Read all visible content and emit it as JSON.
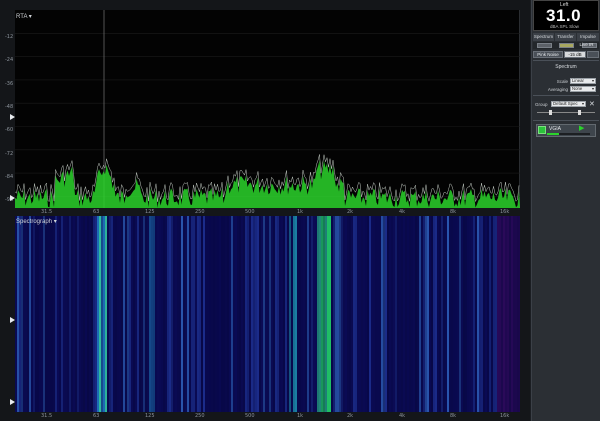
{
  "meter": {
    "channel": "Left",
    "value": "31.0",
    "unit": "dBA SPL Slow"
  },
  "tabs": [
    "Spectrum",
    "Transfer",
    "Impulse"
  ],
  "toolbar": {
    "pink_noise": "Pink Noise",
    "live_ir": "Live IR",
    "level": "-15 dB"
  },
  "spectrum_settings": {
    "title": "Spectrum",
    "scale_label": "Scale",
    "scale_value": "Linear",
    "averaging_label": "Averaging",
    "averaging_value": "None",
    "group_label": "Group",
    "group_value": "Default Spec"
  },
  "input": {
    "name": "VGIA"
  },
  "rta": {
    "label": "RTA ▾",
    "y_ticks": [
      "-12",
      "-24",
      "-36",
      "-48",
      "-60",
      "-72",
      "-84",
      "-96"
    ],
    "x_ticks": [
      "31.5",
      "63",
      "125",
      "250",
      "500",
      "1k",
      "2k",
      "4k",
      "8k",
      "16k"
    ]
  },
  "spectrograph": {
    "label": "Spectrograph ▾"
  },
  "colors": {
    "trace": "#2bd32b",
    "spectro_bg": "#06063a",
    "spectro_hot": "#22d36a"
  }
}
